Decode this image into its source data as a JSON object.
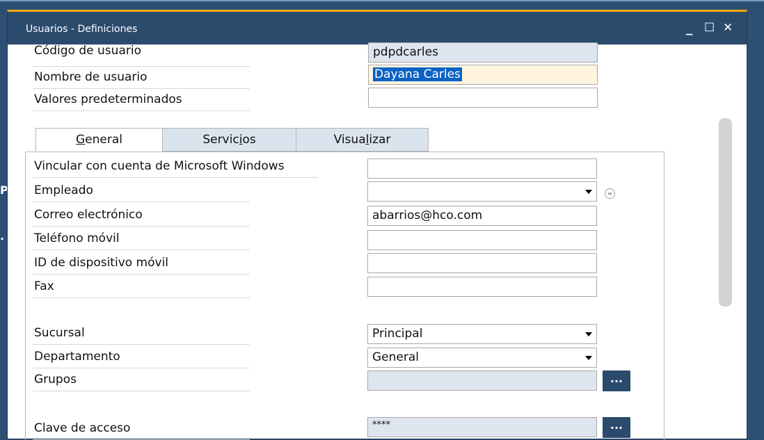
{
  "background": {
    "glyphs": [
      "P",
      "."
    ]
  },
  "window": {
    "title": "Usuarios - Definiciones",
    "controls": {
      "minimize": "_",
      "maximize": "☐",
      "close": "✕"
    }
  },
  "header_fields": [
    {
      "label": "Código de usuario",
      "value": "pdpdcarles"
    },
    {
      "label": "Nombre de usuario",
      "value": "Dayana Carles"
    },
    {
      "label": "Valores predeterminados",
      "value": ""
    }
  ],
  "tabs": [
    {
      "pre": "",
      "accel": "G",
      "post": "eneral"
    },
    {
      "pre": "Servic",
      "accel": "i",
      "post": "os"
    },
    {
      "pre": "Visua",
      "accel": "l",
      "post": "izar"
    }
  ],
  "general": {
    "windows_account": {
      "label": "Vincular con cuenta de Microsoft Windows",
      "value": ""
    },
    "employee": {
      "label": "Empleado",
      "value": ""
    },
    "email": {
      "label": "Correo electrónico",
      "value": "abarrios@hco.com"
    },
    "mobile_phone": {
      "label": "Teléfono móvil",
      "value": ""
    },
    "mobile_device_id": {
      "label": "ID de dispositivo móvil",
      "value": ""
    },
    "fax": {
      "label": "Fax",
      "value": ""
    },
    "branch": {
      "label": "Sucursal",
      "value": "Principal"
    },
    "department": {
      "label": "Departamento",
      "value": "General"
    },
    "groups": {
      "label": "Grupos",
      "value": "",
      "button": "..."
    },
    "password": {
      "label": "Clave de acceso",
      "value": "****",
      "button": "..."
    }
  },
  "colors": {
    "titlebar": "#2b4b6d",
    "accent": "#f0a800",
    "readonly_field": "#dde6ef",
    "selection": "#0a62c3"
  },
  "icons": {
    "info": "info-circle-icon",
    "dropdown": "chevron-down-icon"
  }
}
